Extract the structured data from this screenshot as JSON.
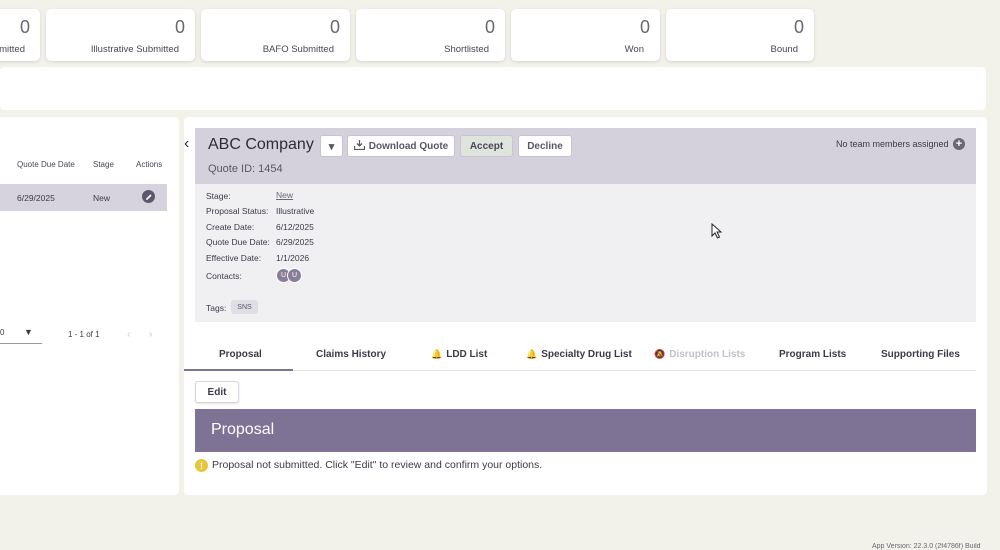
{
  "stats": [
    {
      "value": "0",
      "label": "mitted"
    },
    {
      "value": "0",
      "label": "Illustrative Submitted"
    },
    {
      "value": "0",
      "label": "BAFO Submitted"
    },
    {
      "value": "0",
      "label": "Shortlisted"
    },
    {
      "value": "0",
      "label": "Won"
    },
    {
      "value": "0",
      "label": "Bound"
    }
  ],
  "left_table": {
    "headers": {
      "due_date": "Quote Due Date",
      "stage": "Stage",
      "actions": "Actions"
    },
    "row": {
      "due_date": "6/29/2025",
      "stage": "New",
      "action_icon": "pencil-icon"
    },
    "pager": {
      "per_page": "0",
      "range": "1 - 1 of 1",
      "prev": "‹",
      "next": "›"
    }
  },
  "quote": {
    "company": "ABC Company",
    "quote_id": "Quote ID: 1454",
    "dropdown_icon": "▾",
    "download_label": "Download Quote",
    "accept_label": "Accept",
    "decline_label": "Decline",
    "team_text": "No team members assigned",
    "add_icon": "+",
    "details": {
      "stage_label": "Stage:",
      "stage_value": "New",
      "status_label": "Proposal Status:",
      "status_value": "Illustrative",
      "create_label": "Create Date:",
      "create_value": "6/12/2025",
      "due_label": "Quote Due Date:",
      "due_value": "6/29/2025",
      "effective_label": "Effective Date:",
      "effective_value": "1/1/2026",
      "contacts_label": "Contacts:",
      "contact_initials": [
        "U",
        "U"
      ],
      "tags_label": "Tags:",
      "tag": "SNS"
    }
  },
  "tabs": [
    {
      "label": "Proposal",
      "active": true
    },
    {
      "label": "Claims History"
    },
    {
      "label": "LDD List",
      "icon": "bell-icon"
    },
    {
      "label": "Specialty Drug List",
      "icon": "bell-icon"
    },
    {
      "label": "Disruption Lists",
      "icon": "bell-off-icon",
      "disabled": true
    },
    {
      "label": "Program Lists"
    },
    {
      "label": "Supporting Files"
    }
  ],
  "proposal": {
    "edit_label": "Edit",
    "title": "Proposal",
    "info_icon": "!",
    "message": "Proposal not submitted. Click \"Edit\" to review and confirm your options."
  },
  "footer": {
    "version": "App Version: 22.3.0 (2f4786f) Build"
  },
  "colors": {
    "accent": "#7e7394",
    "header_bg": "#d4d0dc",
    "page_bg": "#f2f1ea",
    "bell": "#e5b12c"
  }
}
